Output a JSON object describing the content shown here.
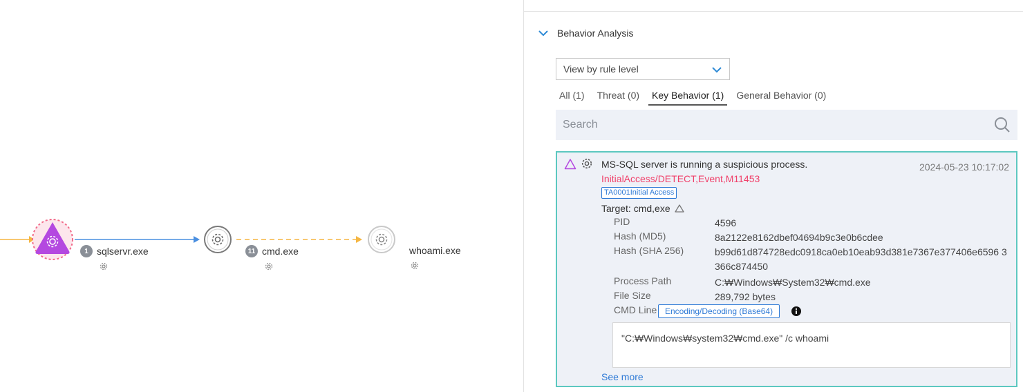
{
  "graph": {
    "nodes": [
      {
        "label": "sqlservr.exe",
        "badge": "1",
        "icon": "gear-icon"
      },
      {
        "label": "cmd.exe",
        "badge": "11",
        "icon": "gear-icon"
      },
      {
        "label": "whoami.exe",
        "badge": "",
        "icon": "gear-icon"
      }
    ],
    "colors": {
      "threat_node": "#b448e0",
      "threat_ring": "#f26b8a",
      "edge_solid": "#4a8fe0",
      "edge_dashed": "#f5b642",
      "edge_incoming": "#f5b642"
    }
  },
  "panel": {
    "section_title": "Behavior Analysis",
    "view_select": {
      "selected": "View by rule level"
    },
    "tabs": [
      {
        "label": "All (1)",
        "active": false
      },
      {
        "label": "Threat (0)",
        "active": false
      },
      {
        "label": "Key Behavior (1)",
        "active": true
      },
      {
        "label": "General Behavior (0)",
        "active": false
      }
    ],
    "search": {
      "placeholder": "Search"
    },
    "card": {
      "title": "MS-SQL server is running a suspicious process.",
      "timestamp": "2024-05-23 10:17:02",
      "rule": "InitialAccess/DETECT,Event,M11453",
      "tag": "TA0001Initial Access",
      "target": "Target: cmd,exe",
      "details": [
        {
          "key": "PID",
          "value": "4596"
        },
        {
          "key": "Hash (MD5)",
          "value": "8a2122e8162dbef04694b9c3e0b6cdee"
        },
        {
          "key": "Hash (SHA 256)",
          "value": "b99d61d874728edc0918ca0eb10eab93d381e7367e377406e6596 3366c874450"
        },
        {
          "key": "Process Path",
          "value": "C:₩Windows₩System32₩cmd.exe"
        },
        {
          "key": "File Size",
          "value": "289,792 bytes"
        }
      ],
      "cmd_line_label": "CMD Line",
      "encode_button": "Encoding/Decoding (Base64)",
      "cmd_text": "\"C:₩Windows₩system32₩cmd.exe\" /c whoami",
      "see_more": "See more",
      "colors": {
        "border": "#5cc8c0",
        "rule": "#f0406a",
        "link": "#2e7ad6"
      }
    }
  }
}
